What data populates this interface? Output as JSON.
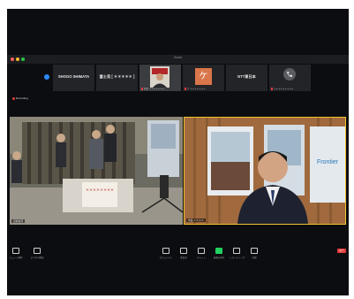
{
  "window": {
    "title": "Zoom",
    "recording": "Recording"
  },
  "participants_strip": [
    {
      "name": "SHOGO SHIMATA",
      "caption": ""
    },
    {
      "name": "富士見 [ ＊＊＊＊＊ ]",
      "caption": ""
    },
    {
      "name": "",
      "caption": "佐藤 ＊＊＊＊＊＊＊"
    },
    {
      "name": "ケ",
      "caption": "ケ ＊＊＊＊＊＊＊"
    },
    {
      "name": "NTT東日本",
      "caption": ""
    },
    {
      "name": "",
      "caption": "＊＊＊＊＊＊＊＊＊"
    }
  ],
  "videos": {
    "left_label": "記者会見",
    "right_label": "市長 ＊＊＊＊",
    "left_sign": "＊＊＊＊＊＊＊＊",
    "right_poster_text": "Frontier"
  },
  "toolbar": {
    "items": [
      "ミュート解除",
      "ビデオの開始",
      "セキュリティ",
      "参加者",
      "チャット",
      "画面を共有",
      "レコーディング",
      "詳細"
    ],
    "end_label": "終了"
  },
  "colors": {
    "accent": "#2d8cff",
    "active_speaker_border": "#f2c230",
    "end_button": "#e23c3c"
  }
}
